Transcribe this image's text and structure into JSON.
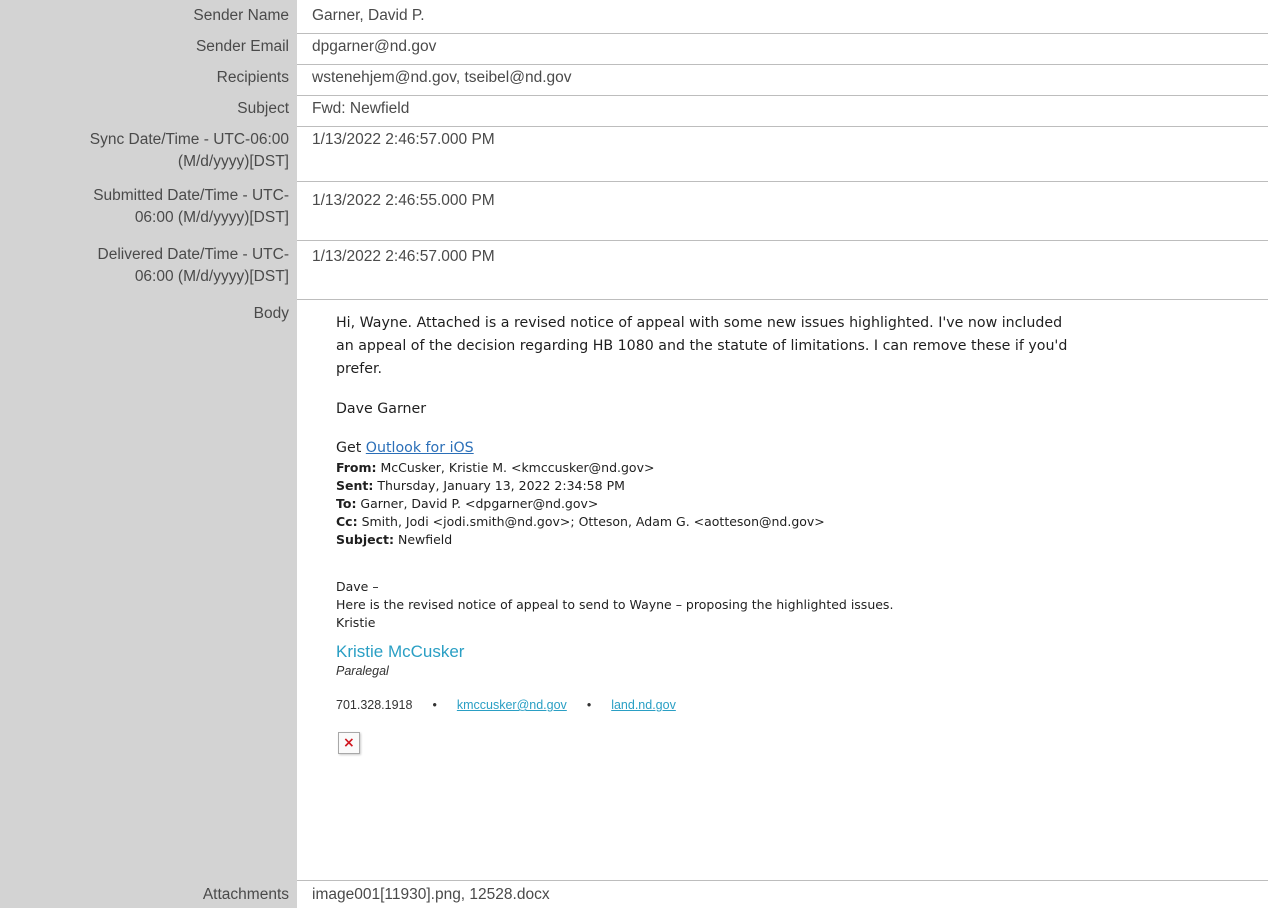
{
  "fields": {
    "sender_name": {
      "label": "Sender Name",
      "value": "Garner, David P."
    },
    "sender_email": {
      "label": "Sender Email",
      "value": "dpgarner@nd.gov"
    },
    "recipients": {
      "label": "Recipients",
      "value": "wstenehjem@nd.gov, tseibel@nd.gov"
    },
    "subject": {
      "label": "Subject",
      "value": "Fwd: Newfield"
    },
    "sync": {
      "label_1": "Sync Date/Time - UTC-06:00",
      "label_2": "(M/d/yyyy)[DST]",
      "value": "1/13/2022 2:46:57.000 PM"
    },
    "submitted": {
      "label_1": "Submitted Date/Time - UTC-",
      "label_2": "06:00 (M/d/yyyy)[DST]",
      "value": "1/13/2022 2:46:55.000 PM"
    },
    "delivered": {
      "label_1": "Delivered Date/Time - UTC-",
      "label_2": "06:00 (M/d/yyyy)[DST]",
      "value": "1/13/2022 2:46:57.000 PM"
    },
    "body": {
      "label": "Body"
    },
    "attachments": {
      "label": "Attachments",
      "value": "image001[11930].png, 12528.docx"
    }
  },
  "email_body": {
    "para_line_1": "Hi, Wayne.  Attached is a revised notice of appeal with some new issues highlighted.  I've now included",
    "para_line_2": "an appeal of the decision regarding HB 1080 and the statute of limitations.  I can remove these if you'd",
    "para_line_3": "prefer.",
    "signoff": "Dave Garner",
    "get_prefix": "Get ",
    "outlook_link": "Outlook for iOS",
    "forward_header": {
      "from_label": "From:",
      "from_value": " McCusker, Kristie M. <kmccusker@nd.gov>",
      "sent_label": "Sent:",
      "sent_value": " Thursday, January 13, 2022 2:34:58 PM",
      "to_label": "To:",
      "to_value": " Garner, David P. <dpgarner@nd.gov>",
      "cc_label": "Cc:",
      "cc_value": " Smith, Jodi <jodi.smith@nd.gov>; Otteson, Adam G. <aotteson@nd.gov>",
      "subject_label": "Subject:",
      "subject_value": " Newfield"
    },
    "fwd_line_1": "Dave –",
    "fwd_line_2": "Here is the revised notice of appeal to send to Wayne – proposing the highlighted issues.",
    "fwd_line_3": "Kristie",
    "signature": {
      "name": "Kristie McCusker",
      "title": "Paralegal",
      "phone": "701.328.1918",
      "bullet": "•",
      "email_link": "kmccusker@nd.gov",
      "site_link": "land.nd.gov"
    },
    "broken_image_glyph": "×"
  }
}
